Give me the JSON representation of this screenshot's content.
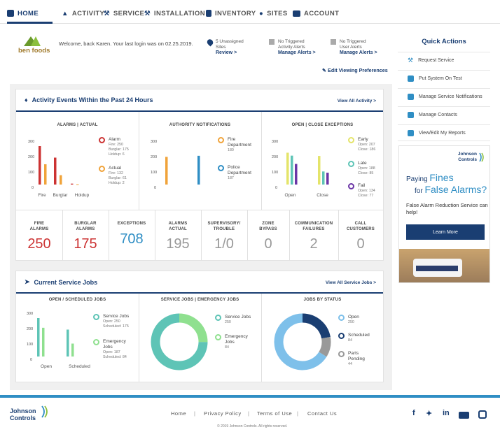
{
  "nav": {
    "items": [
      "HOME",
      "ACTIVITY",
      "SERVICE",
      "INSTALLATION",
      "INVENTORY",
      "SITES",
      "ACCOUNT"
    ],
    "accent": "#1a3e72"
  },
  "welcome": {
    "logo_text": "ben foods",
    "message": "Welcome, back Karen. Your last login was on 02.25.2019.",
    "alerts": [
      {
        "line1": "5 Unassigned",
        "line2": "Sites",
        "link": "Review >"
      },
      {
        "line1": "No Triggered",
        "line2": "Activity Alerts",
        "link": "Manage Alerts >"
      },
      {
        "line1": "No Triggered",
        "line2": "User Alerts",
        "link": "Manage Alerts >"
      }
    ],
    "edit_link": "Edit Viewing Preferences"
  },
  "activity": {
    "title": "Activity Events Within the Past 24 Hours",
    "view_all": "View All Activity >",
    "alarms_actual": {
      "heading": "ALARMS | ACTUAL",
      "y_ticks": [
        "300",
        "200",
        "100",
        "0"
      ],
      "categories": [
        "Fire",
        "Burglar",
        "Holdup"
      ],
      "alarm": {
        "label": "Alarm",
        "fire": "Fire: 250",
        "burglar": "Burglar: 175",
        "holdup": "Holdup: 6",
        "values": [
          250,
          175,
          6
        ]
      },
      "actual": {
        "label": "Actual",
        "fire": "Fire: 132",
        "burglar": "Burglar: 61",
        "holdup": "Holdup: 2",
        "values": [
          132,
          61,
          2
        ]
      }
    },
    "authority": {
      "heading": "AUTHORITY NOTIFICATIONS",
      "y_ticks": [
        "300",
        "200",
        "100",
        "0"
      ],
      "fire": {
        "label1": "Fire",
        "label2": "Department",
        "value_text": "180",
        "value": 180
      },
      "police": {
        "label1": "Police",
        "label2": "Department",
        "value_text": "187",
        "value": 187
      }
    },
    "open_close": {
      "heading": "OPEN | CLOSE EXCEPTIONS",
      "y_ticks": [
        "300",
        "200",
        "100",
        "0"
      ],
      "categories": [
        "Open",
        "Close"
      ],
      "early": {
        "label": "Early",
        "open": "Open: 207",
        "close": "Close: 186",
        "values": [
          207,
          186
        ]
      },
      "late": {
        "label": "Late",
        "open": "Open: 188",
        "close": "Close: 85",
        "values": [
          188,
          85
        ]
      },
      "fail": {
        "label": "Fail",
        "open": "Open: 134",
        "close": "Close: 77",
        "values": [
          134,
          77
        ]
      }
    },
    "stats": [
      {
        "label1": "FIRE",
        "label2": "ALARMS",
        "value": "250",
        "color": "#cc3333"
      },
      {
        "label1": "BURGLAR",
        "label2": "ALARMS",
        "value": "175",
        "color": "#cc3333"
      },
      {
        "label1": "EXCEPTIONS",
        "label2": "",
        "value": "708",
        "color": "#2f8ec4"
      },
      {
        "label1": "ALARMS",
        "label2": "ACTUAL",
        "value": "195",
        "color": "#999999"
      },
      {
        "label1": "SUPERVISORY/",
        "label2": "TROUBLE",
        "value": "1/0",
        "color": "#999999"
      },
      {
        "label1": "ZONE",
        "label2": "BYPASS",
        "value": "0",
        "color": "#999999"
      },
      {
        "label1": "COMMUNICATION",
        "label2": "FAILURES",
        "value": "2",
        "color": "#999999"
      },
      {
        "label1": "CALL",
        "label2": "CUSTOMERS",
        "value": "0",
        "color": "#999999"
      }
    ]
  },
  "service": {
    "title": "Current Service Jobs",
    "view_all": "View All Service Jobs >",
    "open_scheduled": {
      "heading": "OPEN / SCHEDULED JOBS",
      "y_ticks": [
        "300",
        "200",
        "100",
        "0"
      ],
      "categories": [
        "Open",
        "Scheduled"
      ],
      "service": {
        "label": "Service Jobs",
        "open": "Open: 250",
        "scheduled": "Scheduled: 175",
        "values": [
          250,
          175
        ]
      },
      "emergency": {
        "label1": "Emergency",
        "label2": "Jobs",
        "open": "Open: 187",
        "scheduled": "Scheduled: 84",
        "values": [
          187,
          84
        ]
      }
    },
    "service_emergency": {
      "heading": "SERVICE JOBS | EMERGENCY JOBS",
      "service": {
        "label": "Service Jobs",
        "value_text": "250",
        "value": 250
      },
      "emergency": {
        "label1": "Emergency",
        "label2": "Jobs",
        "value_text": "84",
        "value": 84
      }
    },
    "by_status": {
      "heading": "JOBS BY STATUS",
      "open": {
        "label": "Open",
        "value_text": "250",
        "value": 250
      },
      "scheduled": {
        "label": "Scheduled",
        "value_text": "84",
        "value": 84
      },
      "parts": {
        "label1": "Parts",
        "label2": "Pending",
        "value_text": "44",
        "value": 44
      }
    }
  },
  "quick_actions": {
    "title": "Quick Actions",
    "items": [
      "Request Service",
      "Put System On Test",
      "Manage Service Notifications",
      "Manage Contacts",
      "View/Edit My Reports"
    ]
  },
  "ad": {
    "brand1": "Johnson",
    "brand2": "Controls",
    "line1a": "Paying",
    "line1b": "Fines",
    "line2a": "for",
    "line2b": "False Alarms?",
    "body": "False Alarm Reduction Service can help!",
    "button": "Learn More"
  },
  "footer": {
    "brand1": "Johnson",
    "brand2": "Controls",
    "links": [
      "Home",
      "Privacy Policy",
      "Terms of Use",
      "Contact Us"
    ],
    "copyright": "© 2019 Johnson Controls. All rights reserved.",
    "social": [
      "f",
      "twitter",
      "in",
      "youtube",
      "instagram"
    ]
  },
  "colors": {
    "red": "#cc3333",
    "orange": "#f0a33a",
    "yellow": "#e4e46a",
    "teal": "#5ec4b6",
    "purple": "#6b35a6",
    "blue": "#2f8ec4",
    "navy": "#1a3e72",
    "green": "#8fe08f",
    "grey": "#999999",
    "light_blue": "#7ec0ea"
  }
}
